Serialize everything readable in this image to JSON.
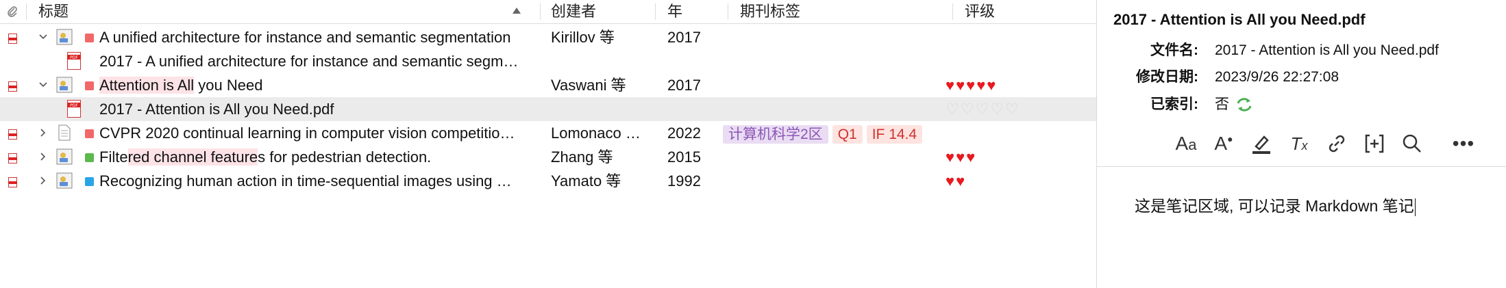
{
  "columns": {
    "title": "标题",
    "creator": "创建者",
    "year": "年",
    "journal_tags": "期刊标签",
    "rating": "评级"
  },
  "rows": [
    {
      "title": "A unified architecture for instance and semantic segmentation",
      "creator": "Kirillov 等",
      "year": "2017",
      "color": "#f26868",
      "rating": 0
    },
    {
      "title": "2017 - A unified architecture for instance and semantic segm…",
      "creator": "",
      "year": ""
    },
    {
      "title_a": "Attention is All",
      "title_b": " you Need",
      "creator": "Vaswani 等",
      "year": "2017",
      "color": "#f26868",
      "rating": 5
    },
    {
      "title": "2017 - Attention is All you Need.pdf",
      "creator": "",
      "year": "",
      "rating": 0
    },
    {
      "title": "CVPR 2020 continual learning in computer vision competitio…",
      "creator": "Lomonaco …",
      "year": "2022",
      "color": "#f26868",
      "tags": [
        "计算机科学2区",
        "Q1",
        "IF 14.4"
      ]
    },
    {
      "title_a": "Filte",
      "title_b": "red channel feature",
      "title_c": "s for pedestrian detection.",
      "creator": "Zhang 等",
      "year": "2015",
      "color": "#5bb94d",
      "rating": 3
    },
    {
      "title": "Recognizing human action in time-sequential images using …",
      "creator": "Yamato 等",
      "year": "1992",
      "color": "#2aa4e8",
      "rating": 2
    }
  ],
  "tag_colors": {
    "cas": "#e9dcf3",
    "cas_text": "#8d56b7",
    "q": "#fde4e1",
    "q_text": "#d0312d"
  },
  "pane": {
    "title": "2017 - Attention is All you Need.pdf",
    "filename_label": "文件名:",
    "filename": "2017 - Attention is All you Need.pdf",
    "modified_label": "修改日期:",
    "modified": "2023/9/26 22:27:08",
    "indexed_label": "已索引:",
    "indexed": "否",
    "note": "这是笔记区域, 可以记录 Markdown 笔记"
  },
  "icons": {
    "attachment": "paperclip-icon",
    "toolbar": [
      "font-size-icon",
      "font-color-icon",
      "highlight-icon",
      "clear-format-icon",
      "link-icon",
      "insert-citation-icon",
      "search-icon",
      "more-icon"
    ]
  }
}
